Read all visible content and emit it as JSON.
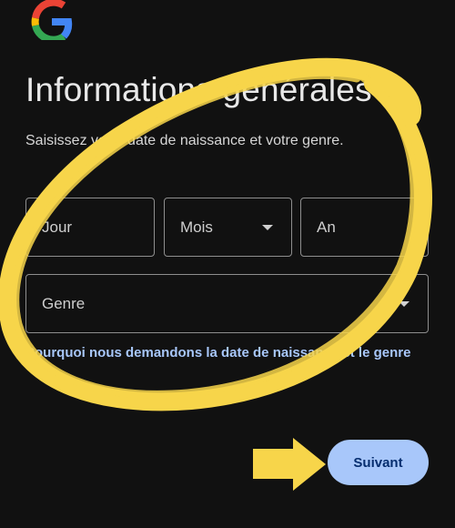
{
  "logo": {
    "icon": "google-g-logo-icon",
    "colors": [
      "#4285F4",
      "#EA4335",
      "#FBBC05",
      "#34A853"
    ]
  },
  "page": {
    "title": "Informations générales",
    "subtitle": "Saisissez votre date de naissance et votre genre."
  },
  "fields": {
    "day": {
      "label": "Jour"
    },
    "month": {
      "label": "Mois",
      "icon": "dropdown-caret-icon"
    },
    "year": {
      "label": "An"
    },
    "gender": {
      "label": "Genre",
      "icon": "dropdown-caret-icon"
    }
  },
  "help_link": {
    "text": "Pourquoi nous demandons la date de naissance et le genre"
  },
  "actions": {
    "next_label": "Suivant"
  },
  "annotation": {
    "color": "#f7d54a",
    "shapes": [
      "scribbled-circle",
      "arrow-right"
    ]
  },
  "colors": {
    "background": "#111111",
    "link": "#a8c7fa",
    "button_bg": "#a8c7fa",
    "button_text": "#062e6f"
  }
}
